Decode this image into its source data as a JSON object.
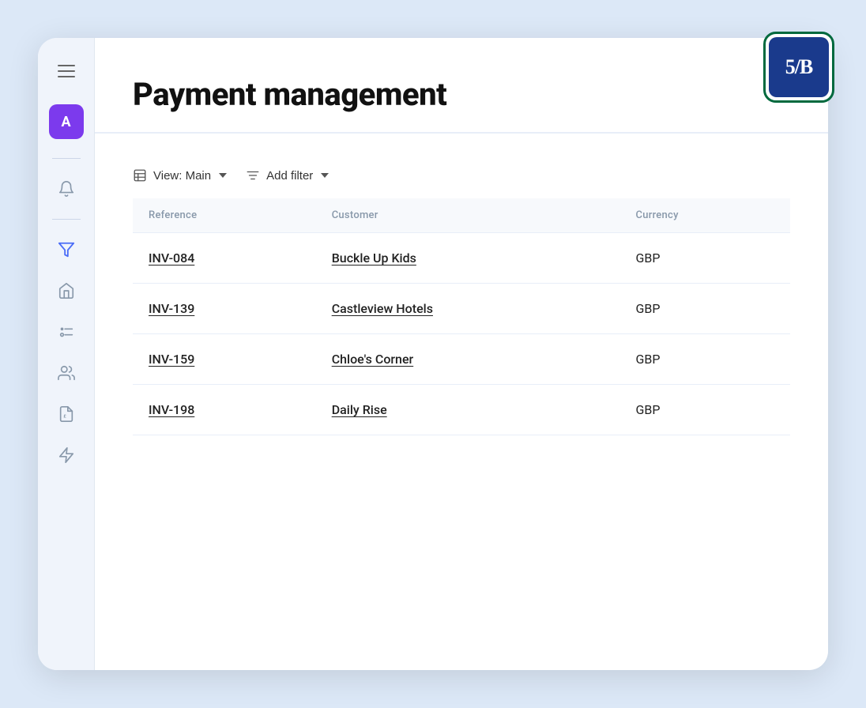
{
  "app": {
    "title": "Payment management",
    "logo_text": "5/B"
  },
  "sidebar": {
    "avatar_label": "A",
    "items": [
      {
        "name": "hamburger-menu",
        "icon": "menu"
      },
      {
        "name": "avatar",
        "icon": "A"
      },
      {
        "name": "notifications-icon",
        "icon": "bell"
      },
      {
        "name": "filter-icon",
        "icon": "filter-y"
      },
      {
        "name": "home-icon",
        "icon": "home"
      },
      {
        "name": "tasks-icon",
        "icon": "tasks"
      },
      {
        "name": "users-icon",
        "icon": "users"
      },
      {
        "name": "invoice-icon",
        "icon": "file-pound"
      },
      {
        "name": "lightning-icon",
        "icon": "lightning"
      }
    ]
  },
  "toolbar": {
    "view_label": "View: Main",
    "filter_label": "Add filter"
  },
  "table": {
    "columns": [
      "Reference",
      "Customer",
      "Currency"
    ],
    "rows": [
      {
        "reference": "INV-084",
        "customer": "Buckle Up Kids",
        "currency": "GBP"
      },
      {
        "reference": "INV-139",
        "customer": "Castleview Hotels",
        "currency": "GBP"
      },
      {
        "reference": "INV-159",
        "customer": "Chloe's Corner",
        "currency": "GBP"
      },
      {
        "reference": "INV-198",
        "customer": "Daily Rise",
        "currency": "GBP"
      }
    ]
  },
  "colors": {
    "avatar_bg": "#7c3aed",
    "logo_border": "#00693e",
    "logo_bg": "#1a3a8c",
    "active_icon": "#4a6cf7"
  }
}
